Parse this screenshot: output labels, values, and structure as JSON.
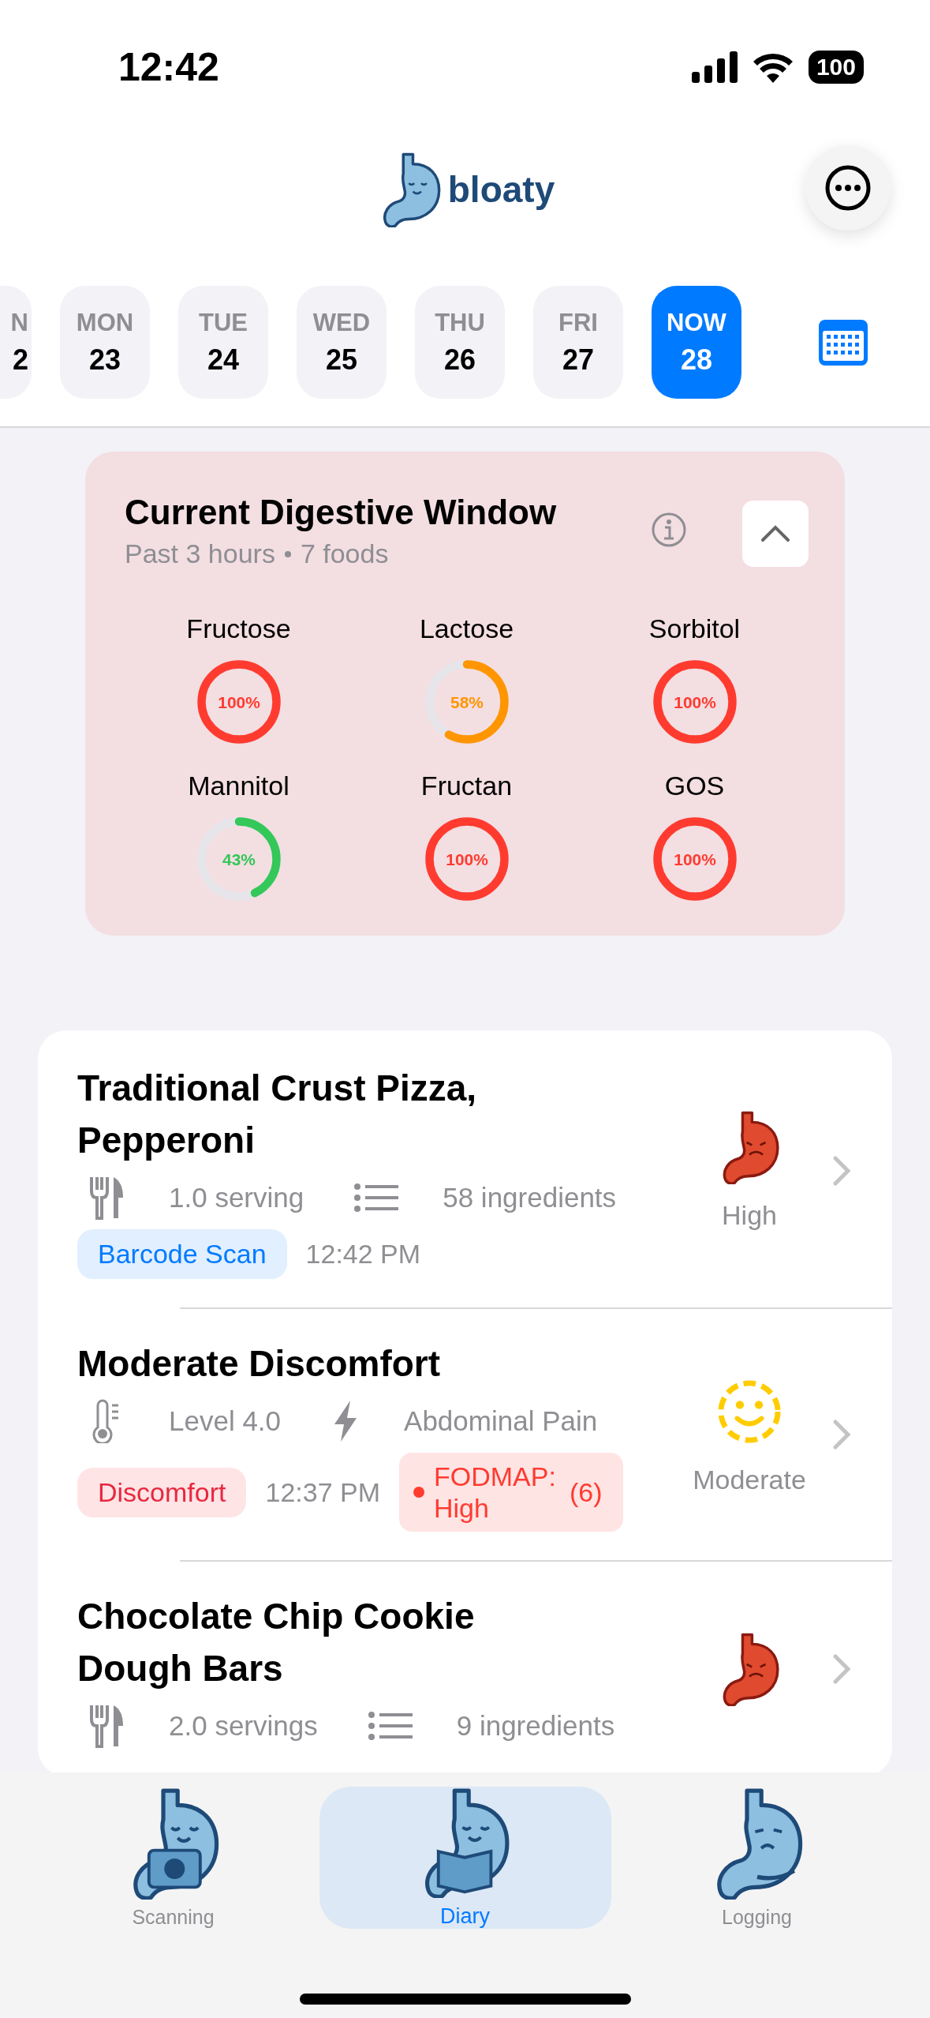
{
  "status_bar": {
    "time": "12:42",
    "battery": "100"
  },
  "header": {
    "app_name": "bloaty"
  },
  "days": [
    {
      "weekday": "N",
      "day": "2",
      "selected": false
    },
    {
      "weekday": "MON",
      "day": "23",
      "selected": false
    },
    {
      "weekday": "TUE",
      "day": "24",
      "selected": false
    },
    {
      "weekday": "WED",
      "day": "25",
      "selected": false
    },
    {
      "weekday": "THU",
      "day": "26",
      "selected": false
    },
    {
      "weekday": "FRI",
      "day": "27",
      "selected": false
    },
    {
      "weekday": "NOW",
      "day": "28",
      "selected": true
    }
  ],
  "digestive_window": {
    "title": "Current Digestive Window",
    "period": "Past 3 hours",
    "count": "7 foods",
    "expanded": true,
    "rings": [
      {
        "name": "Fructose",
        "reading": "100%",
        "level": 1,
        "color": "#ff3b30"
      },
      {
        "name": "Lactose",
        "reading": "58%",
        "level": 0.58,
        "color": "#ff9500"
      },
      {
        "name": "Sorbitol",
        "reading": "100%",
        "level": 1,
        "color": "#ff3b30"
      },
      {
        "name": "Mannitol",
        "reading": "43%",
        "level": 0.43,
        "color": "#34c759"
      },
      {
        "name": "Fructan",
        "reading": "100%",
        "level": 1,
        "color": "#ff3b30"
      },
      {
        "name": "GOS",
        "reading": "100%",
        "level": 1,
        "color": "#ff3b30"
      }
    ]
  },
  "entries": [
    {
      "kind": "food",
      "title": "Traditional Crust Pizza, Pepperoni",
      "amount": "1.0 serving",
      "detail": "58 ingredients",
      "tag": "Barcode Scan",
      "time": "12:42 PM",
      "rating": {
        "kind": "high",
        "label": "High"
      }
    },
    {
      "kind": "symptom",
      "title": "Moderate Discomfort",
      "amount": "Level 4.0",
      "detail": "Abdominal Pain",
      "tag": "Discomfort",
      "time": "12:37 PM",
      "badge": {
        "text": "FODMAP: High",
        "count": "(6)"
      },
      "rating": {
        "kind": "moderate",
        "label": "Moderate"
      }
    },
    {
      "kind": "food",
      "title": "Chocolate Chip Cookie Dough Bars",
      "amount": "2.0 servings",
      "detail": "9 ingredients",
      "rating": {
        "kind": "high"
      }
    }
  ],
  "tabs": [
    {
      "kind": "camera",
      "label": "Scanning",
      "selected": false
    },
    {
      "kind": "book",
      "label": "Diary",
      "selected": true
    },
    {
      "kind": "thinking",
      "label": "Logging",
      "selected": false
    }
  ]
}
